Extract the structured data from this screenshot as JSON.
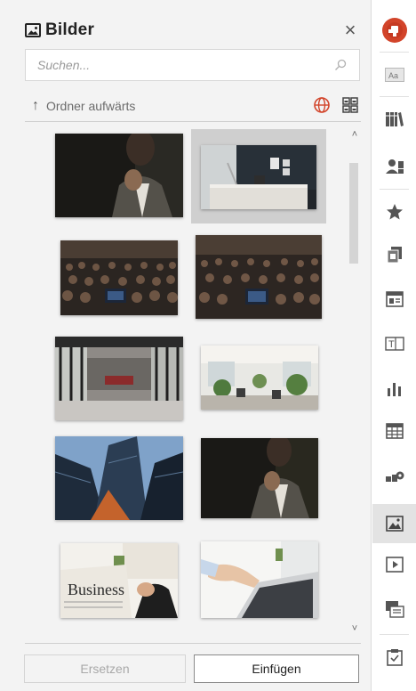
{
  "panel": {
    "title": "Bilder",
    "close_glyph": "×",
    "search": {
      "placeholder": "Suchen...",
      "value": ""
    },
    "folder_up": {
      "label": "Ordner aufwärts",
      "arrow": "🡑"
    },
    "scroll_up_glyph": "˄",
    "scroll_down_glyph": "˅",
    "thumbnails": [
      {
        "subject": "businessman in suit, dark background",
        "selected": false
      },
      {
        "subject": "dark office room with desk and lamp",
        "selected": true
      },
      {
        "subject": "lecture hall audience",
        "selected": false
      },
      {
        "subject": "lecture hall audience",
        "selected": false
      },
      {
        "subject": "office lobby with red chairs and windows",
        "selected": false
      },
      {
        "subject": "bright open office with plants",
        "selected": false
      },
      {
        "subject": "skyscrapers looking up",
        "selected": false
      },
      {
        "subject": "businessman in suit, dark background",
        "selected": false
      },
      {
        "subject": "business newspaper in hands",
        "selected": false
      },
      {
        "subject": "hands typing on laptop",
        "selected": false
      }
    ],
    "buttons": {
      "replace": "Ersetzen",
      "insert": "Einfügen"
    }
  },
  "toolbar": {
    "items": [
      {
        "icon": "brand-logo-icon",
        "active": false
      },
      {
        "icon": "text-style-icon",
        "active": false
      },
      {
        "icon": "library-icon",
        "active": false
      },
      {
        "icon": "contacts-icon",
        "active": false
      },
      {
        "icon": "star-icon",
        "active": false
      },
      {
        "icon": "document-swap-icon",
        "active": false
      },
      {
        "icon": "layout-icon",
        "active": false
      },
      {
        "icon": "text-box-icon",
        "active": false
      },
      {
        "icon": "bar-chart-icon",
        "active": false
      },
      {
        "icon": "table-icon",
        "active": false
      },
      {
        "icon": "process-icon",
        "active": false
      },
      {
        "icon": "image-icon",
        "active": true
      },
      {
        "icon": "video-icon",
        "active": false
      },
      {
        "icon": "slides-icon",
        "active": false
      },
      {
        "icon": "clipboard-check-icon",
        "active": false
      }
    ]
  },
  "colors": {
    "brand": "#d2442a",
    "panel_bg": "#f3f3f3",
    "selected_bg": "#cfcfcf",
    "accent_globe": "#d2442a"
  }
}
